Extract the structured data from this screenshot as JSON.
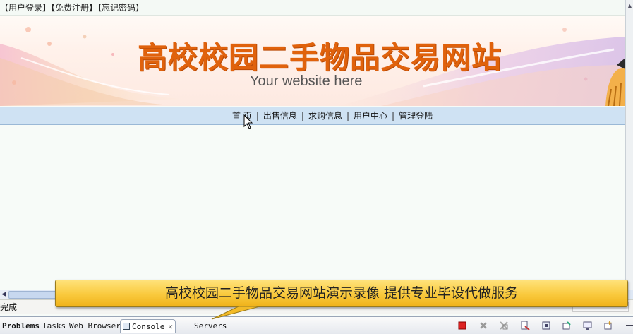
{
  "login_bar": {
    "login": "【用户登录】",
    "register": "【免费注册】",
    "forgot": "【忘记密码】"
  },
  "banner": {
    "title": "高校校园二手物品交易网站",
    "subtitle": "Your website here"
  },
  "nav": {
    "items": [
      "首 页",
      "出售信息",
      "求购信息",
      "用户中心",
      "管理登陆"
    ],
    "separator": "|"
  },
  "status": {
    "text": "完成"
  },
  "bottom_tabs": [
    {
      "label": "Problems",
      "icon": "problems-icon"
    },
    {
      "label": "Tasks",
      "icon": "tasks-icon"
    },
    {
      "label": "Web Browser",
      "icon": "browser-icon"
    },
    {
      "label": "Console",
      "icon": "console-icon",
      "active": true,
      "close": "✕"
    },
    {
      "label": "Servers",
      "icon": "servers-icon"
    }
  ],
  "callout": {
    "text": "高校校园二手物品交易网站演示录像 提供专业毕设代做服务"
  },
  "colors": {
    "title_orange": "#e0620c",
    "nav_bg": "#cfe2f3",
    "callout_yellow": "#f9c93c"
  }
}
